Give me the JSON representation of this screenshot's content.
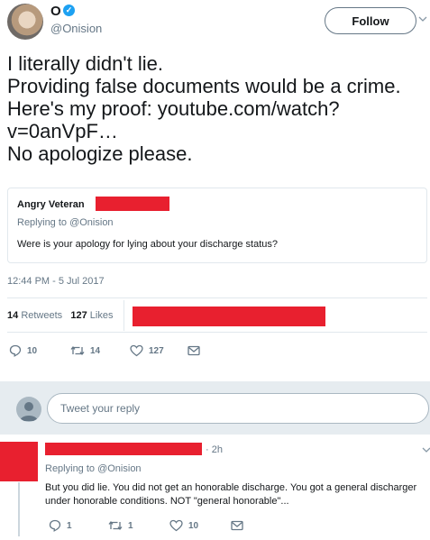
{
  "header": {
    "display_name": "O",
    "verified_icon": "verified-badge-icon",
    "handle": "@Onision",
    "follow_label": "Follow"
  },
  "tweet": {
    "lines": [
      "I literally didn't lie.",
      "Providing false documents would be a crime.",
      "Here's my proof: youtube.com/watch?",
      "v=0anVpF…",
      "No apologize please."
    ],
    "quoted": {
      "name": "Angry Veteran",
      "replying_to": "Replying to @Onision",
      "text": "Were is your apology for lying about your discharge status?"
    },
    "timestamp": "12:44 PM - 5 Jul 2017",
    "stats": {
      "retweets_count": "14",
      "retweets_label": "Retweets",
      "likes_count": "127",
      "likes_label": "Likes"
    },
    "actions": {
      "reply_count": "10",
      "retweet_count": "14",
      "like_count": "127"
    }
  },
  "composer": {
    "placeholder": "Tweet your reply"
  },
  "reply": {
    "time": "· 2h",
    "replying_to": "Replying to @Onision",
    "text": "But you did lie. You did not get an honorable discharge. You got a general discharger under honorable conditions. NOT \"general honorable\"...",
    "actions": {
      "reply_count": "1",
      "retweet_count": "1",
      "like_count": "10"
    }
  },
  "colors": {
    "redaction": "#e8202f",
    "muted": "#657786",
    "verified": "#1da1f2",
    "composer_bg": "#e6ecf0"
  }
}
